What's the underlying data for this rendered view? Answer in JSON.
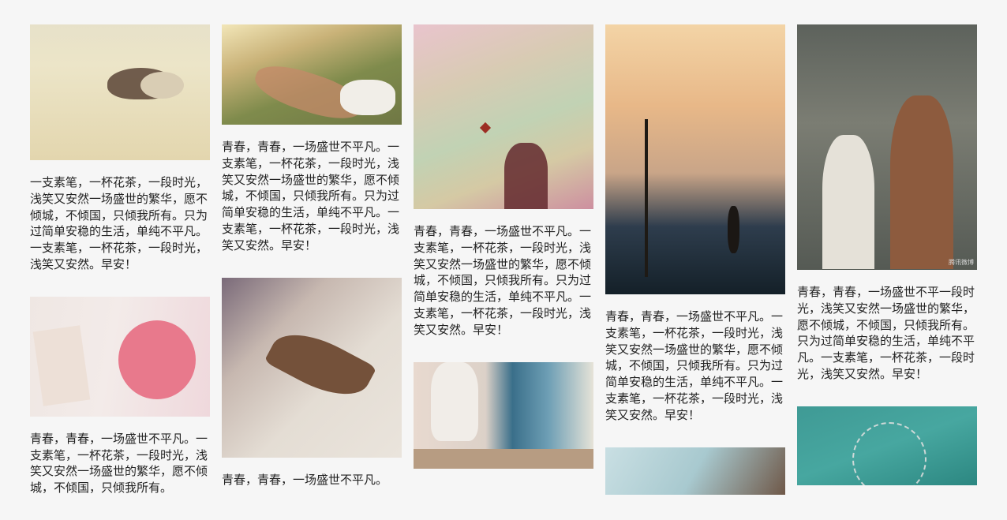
{
  "watermark": "腾讯微博",
  "columns": [
    {
      "cards": [
        {
          "image": "beach-girl-photo",
          "caption": "一支素笔，一杯花茶，一段时光，浅笑又安然一场盛世的繁华，愿不倾城，不倾国，只倾我所有。只为过简单安稳的生活，单纯不平凡。一支素笔，一杯花茶，一段时光，浅笑又安然。早安！"
        },
        {
          "image": "with-love-rose-photo",
          "caption": "青春，青春，一场盛世不平凡。一支素笔，一杯花茶，一段时光，浅笑又安然一场盛世的繁华，愿不倾城，不倾国，只倾我所有。"
        }
      ]
    },
    {
      "cards": [
        {
          "image": "girl-in-grass-photo",
          "caption": "青春，青春，一场盛世不平凡。一支素笔，一杯花茶，一段时光，浅笑又安然一场盛世的繁华，愿不倾城，不倾国，只倾我所有。只为过简单安稳的生活，单纯不平凡。一支素笔，一杯花茶，一段时光，浅笑又安然。早安！"
        },
        {
          "image": "book-and-leaf-photo",
          "caption": "青春，青春，一场盛世不平凡。"
        }
      ]
    },
    {
      "cards": [
        {
          "image": "girl-holding-starfish-photo",
          "caption": "青春，青春，一场盛世不平凡。一支素笔，一杯花茶，一段时光，浅笑又安然一场盛世的繁华，愿不倾城，不倾国，只倾我所有。只为过简单安稳的生活，单纯不平凡。一支素笔，一杯花茶，一段时光，浅笑又安然。早安！"
        },
        {
          "image": "girl-by-blue-door-photo",
          "caption": ""
        }
      ]
    },
    {
      "cards": [
        {
          "image": "fantasy-sky-painting",
          "caption": "青春，青春，一场盛世不平凡。一支素笔，一杯花茶，一段时光，浅笑又安然一场盛世的繁华，愿不倾城，不倾国，只倾我所有。只为过简单安稳的生活，单纯不平凡。一支素笔，一杯花茶，一段时光，浅笑又安然。早安！"
        },
        {
          "image": "girl-profile-painting",
          "caption": ""
        }
      ]
    },
    {
      "cards": [
        {
          "image": "anime-couple-illustration",
          "caption": "青春，青春，一场盛世不平一段时光，浅笑又安然一场盛世的繁华，愿不倾城，不倾国，只倾我所有。只为过简单安稳的生活，单纯不平凡。一支素笔，一杯花茶，一段时光，浅笑又安然。早安！"
        },
        {
          "image": "dandelion-teal-photo",
          "caption": ""
        }
      ]
    }
  ]
}
